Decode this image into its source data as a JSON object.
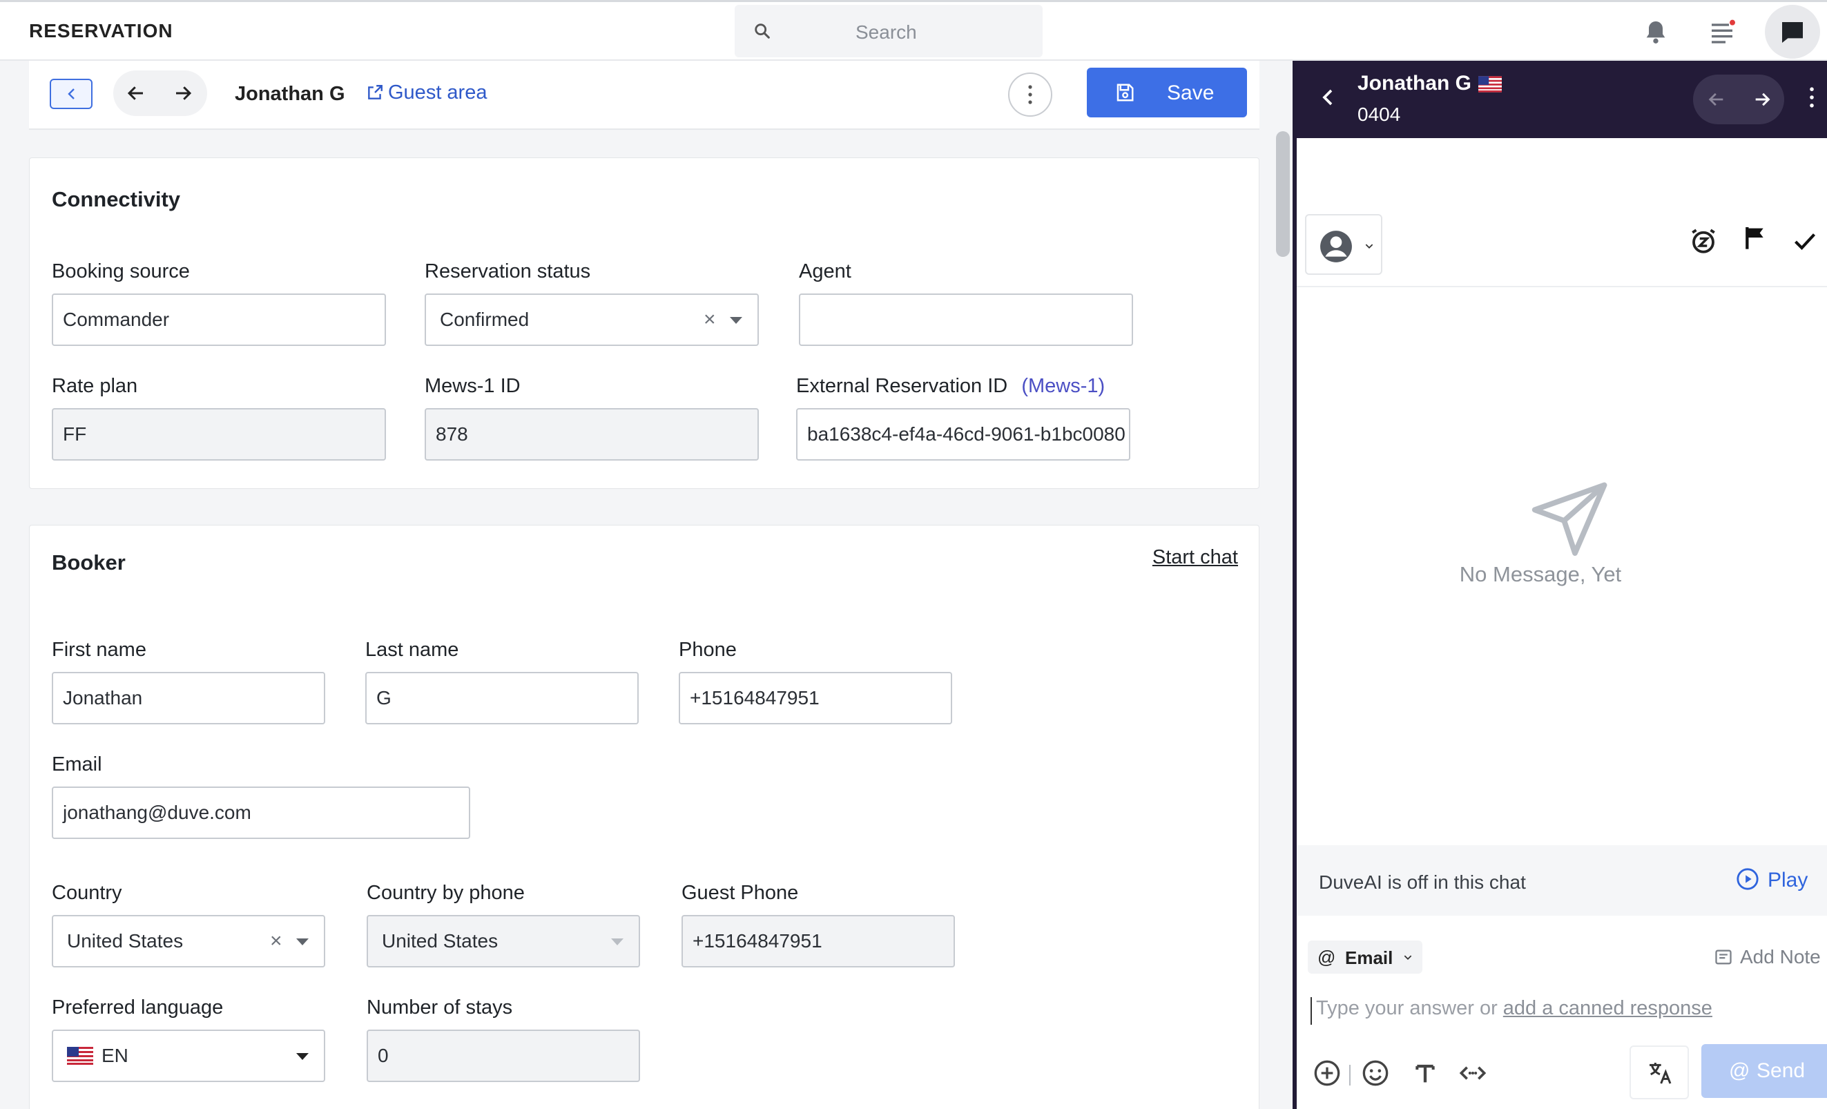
{
  "app": {
    "title": "RESERVATION"
  },
  "search": {
    "placeholder": "Search"
  },
  "actionbar": {
    "guest_name": "Jonathan G",
    "guest_area": "Guest area",
    "save_label": "Save"
  },
  "connectivity": {
    "title": "Connectivity",
    "booking_source": {
      "label": "Booking source",
      "value": "Commander"
    },
    "reservation_status": {
      "label": "Reservation status",
      "value": "Confirmed"
    },
    "agent": {
      "label": "Agent",
      "value": ""
    },
    "rate_plan": {
      "label": "Rate plan",
      "value": "FF"
    },
    "mews_id": {
      "label": "Mews-1 ID",
      "value": "878"
    },
    "external_id": {
      "label": "External Reservation ID",
      "label_suffix": "(Mews-1)",
      "value": "ba1638c4-ef4a-46cd-9061-b1bc0080"
    }
  },
  "booker": {
    "title": "Booker",
    "start_chat": "Start chat",
    "first_name": {
      "label": "First name",
      "value": "Jonathan"
    },
    "last_name": {
      "label": "Last name",
      "value": "G"
    },
    "phone": {
      "label": "Phone",
      "value": "+15164847951"
    },
    "email": {
      "label": "Email",
      "value": "jonathang@duve.com"
    },
    "country": {
      "label": "Country",
      "value": "United States"
    },
    "country_by_phone": {
      "label": "Country by phone",
      "value": "United States"
    },
    "guest_phone": {
      "label": "Guest Phone",
      "value": "+15164847951"
    },
    "preferred_language": {
      "label": "Preferred language",
      "value": "EN"
    },
    "number_of_stays": {
      "label": "Number of stays",
      "value": "0"
    }
  },
  "chat": {
    "guest_name": "Jonathan G",
    "room": "0404",
    "empty_text": "No Message, Yet",
    "ai_status": "DuveAI is off in this chat",
    "play_label": "Play",
    "channel": "Email",
    "add_note": "Add Note",
    "reply_placeholder": "Type your answer or",
    "canned_link": "add a canned response",
    "send_label": "Send"
  },
  "colors": {
    "primary": "#3d6fe6",
    "chat_header": "#231b38",
    "link": "#2f59c9",
    "send_disabled": "#b5cbf5"
  }
}
